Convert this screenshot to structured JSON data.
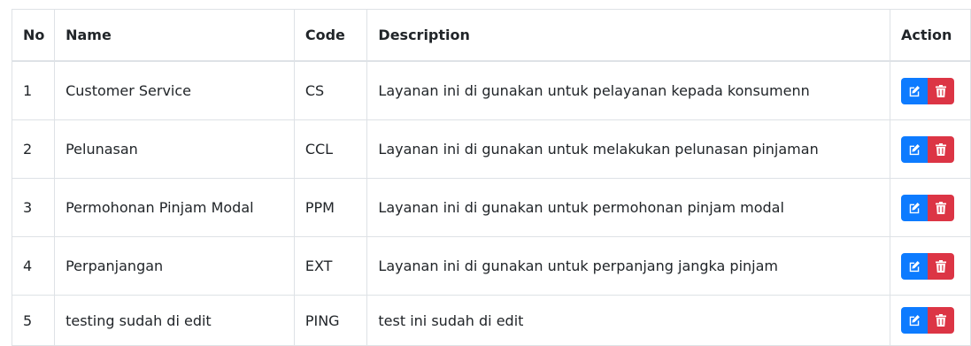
{
  "table": {
    "headers": {
      "no": "No",
      "name": "Name",
      "code": "Code",
      "description": "Description",
      "action": "Action"
    },
    "rows": [
      {
        "no": "1",
        "name": "Customer Service",
        "code": "CS",
        "description": "Layanan ini di gunakan untuk pelayanan kepada konsumenn"
      },
      {
        "no": "2",
        "name": "Pelunasan",
        "code": "CCL",
        "description": "Layanan ini di gunakan untuk melakukan pelunasan pinjaman"
      },
      {
        "no": "3",
        "name": "Permohonan Pinjam Modal",
        "code": "PPM",
        "description": "Layanan ini di gunakan untuk permohonan pinjam modal"
      },
      {
        "no": "4",
        "name": "Perpanjangan",
        "code": "EXT",
        "description": "Layanan ini di gunakan untuk perpanjang jangka pinjam"
      },
      {
        "no": "5",
        "name": "testing sudah di edit",
        "code": "PING",
        "description": "test ini sudah di edit"
      }
    ]
  },
  "colors": {
    "edit_button": "#0d7bff",
    "delete_button": "#dc3545",
    "border": "#dee2e6"
  },
  "icons": {
    "edit": "edit-icon",
    "delete": "trash-icon"
  }
}
